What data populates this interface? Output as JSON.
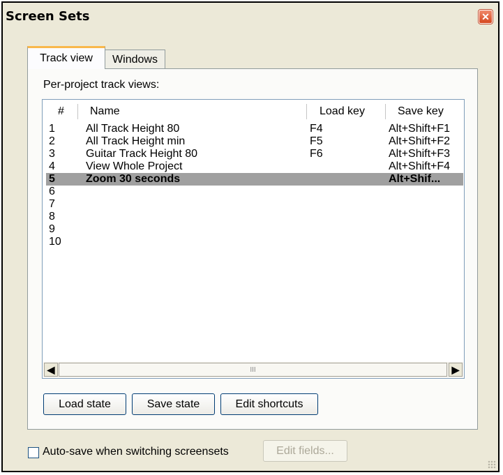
{
  "window": {
    "title": "Screen Sets",
    "close_glyph": "✕"
  },
  "tabs": [
    {
      "label": "Track view",
      "active": true
    },
    {
      "label": "Windows",
      "active": false
    }
  ],
  "panel": {
    "label": "Per-project track views:"
  },
  "list": {
    "columns": [
      "#",
      "Name",
      "Load key",
      "Save key"
    ],
    "rows": [
      {
        "num": "1",
        "name": "All Track Height 80",
        "load": "F4",
        "save": "Alt+Shift+F1",
        "selected": false
      },
      {
        "num": "2",
        "name": "All Track Height min",
        "load": "F5",
        "save": "Alt+Shift+F2",
        "selected": false
      },
      {
        "num": "3",
        "name": "Guitar Track Height 80",
        "load": "F6",
        "save": "Alt+Shift+F3",
        "selected": false
      },
      {
        "num": "4",
        "name": "View Whole Project",
        "load": "",
        "save": "Alt+Shift+F4",
        "selected": false
      },
      {
        "num": "5",
        "name": "Zoom 30 seconds",
        "load": "",
        "save": "Alt+Shif...",
        "selected": true
      },
      {
        "num": "6",
        "name": "",
        "load": "",
        "save": "",
        "selected": false
      },
      {
        "num": "7",
        "name": "",
        "load": "",
        "save": "",
        "selected": false
      },
      {
        "num": "8",
        "name": "",
        "load": "",
        "save": "",
        "selected": false
      },
      {
        "num": "9",
        "name": "",
        "load": "",
        "save": "",
        "selected": false
      },
      {
        "num": "10",
        "name": "",
        "load": "",
        "save": "",
        "selected": false
      }
    ],
    "scroll": {
      "left_glyph": "◀",
      "right_glyph": "▶",
      "thumb_glyph": "III"
    }
  },
  "buttons": {
    "load_state": "Load state",
    "save_state": "Save state",
    "edit_shortcuts": "Edit shortcuts",
    "edit_fields": "Edit fields..."
  },
  "autosave": {
    "label": "Auto-save when switching screensets",
    "checked": false
  },
  "colors": {
    "dialog_bg": "#ece9d8",
    "selected_row": "#a0a0a0",
    "active_tab_accent": "#f9b84b",
    "close_red": "#d5471e"
  }
}
